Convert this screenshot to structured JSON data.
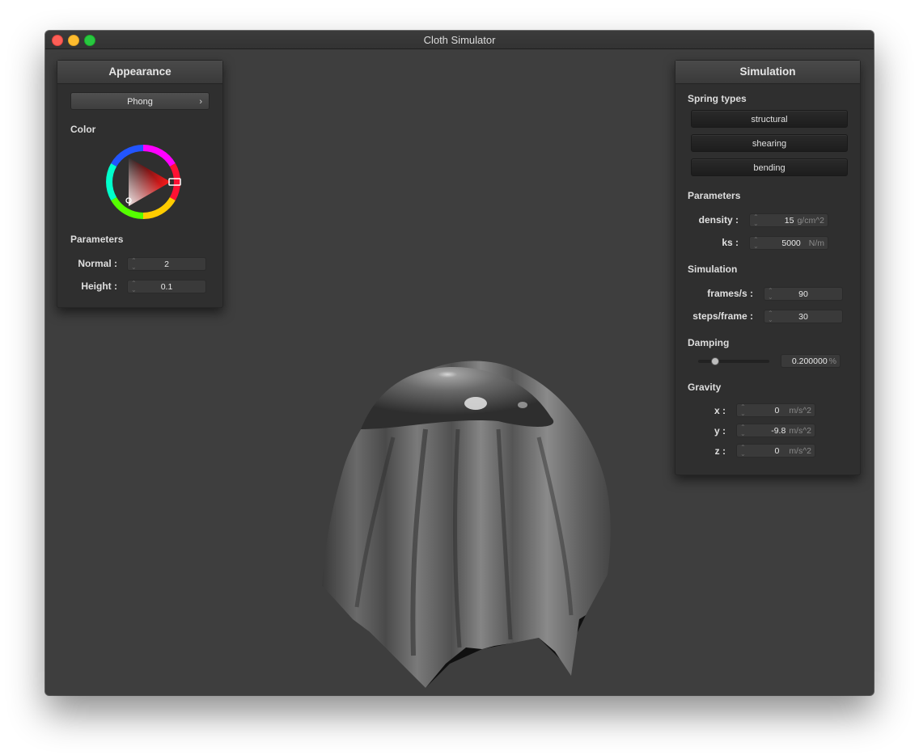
{
  "window": {
    "title": "Cloth Simulator"
  },
  "appearance": {
    "title": "Appearance",
    "shader": {
      "selected": "Phong",
      "chevron": "›"
    },
    "color_label": "Color",
    "params_label": "Parameters",
    "normal": {
      "label": "Normal :",
      "value": "2"
    },
    "height": {
      "label": "Height :",
      "value": "0.1"
    }
  },
  "simulation": {
    "title": "Simulation",
    "spring_types_label": "Spring types",
    "spring_types": [
      "structural",
      "shearing",
      "bending"
    ],
    "parameters_label": "Parameters",
    "density": {
      "label": "density :",
      "value": "15",
      "unit": "g/cm^2"
    },
    "ks": {
      "label": "ks :",
      "value": "5000",
      "unit": "N/m"
    },
    "simulation_label": "Simulation",
    "frames": {
      "label": "frames/s :",
      "value": "90"
    },
    "steps": {
      "label": "steps/frame :",
      "value": "30"
    },
    "damping_label": "Damping",
    "damping": {
      "value": "0.200000",
      "unit": "%",
      "slider_fraction": 0.2
    },
    "gravity_label": "Gravity",
    "gravity": {
      "x": {
        "label": "x :",
        "value": "0",
        "unit": "m/s^2"
      },
      "y": {
        "label": "y :",
        "value": "-9.8",
        "unit": "m/s^2"
      },
      "z": {
        "label": "z :",
        "value": "0",
        "unit": "m/s^2"
      }
    }
  },
  "colors": {
    "selected_color": "#ff0000"
  }
}
